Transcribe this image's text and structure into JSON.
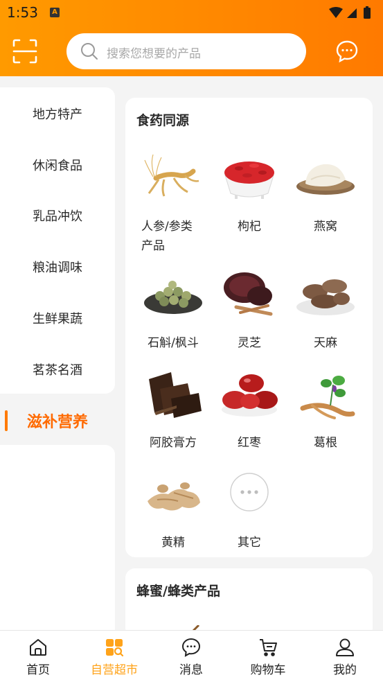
{
  "status_bar": {
    "time": "1:53",
    "badge": "A"
  },
  "search": {
    "placeholder": "搜索您想要的产品"
  },
  "sidebar": {
    "items": [
      {
        "label": "地方特产"
      },
      {
        "label": "休闲食品"
      },
      {
        "label": "乳品冲饮"
      },
      {
        "label": "粮油调味"
      },
      {
        "label": "生鲜果蔬"
      },
      {
        "label": "茗茶名酒"
      }
    ],
    "active": {
      "label": "滋补营养"
    }
  },
  "sections": [
    {
      "title": "食药同源",
      "products": [
        {
          "name": "人参/参类\n产品",
          "icon": "ginseng-image"
        },
        {
          "name": "枸杞",
          "icon": "goji-image"
        },
        {
          "name": "燕窝",
          "icon": "birds-nest-image"
        },
        {
          "name": "石斛/枫斗",
          "icon": "dendrobium-image"
        },
        {
          "name": "灵芝",
          "icon": "lingzhi-image"
        },
        {
          "name": "天麻",
          "icon": "gastrodia-image"
        },
        {
          "name": "阿胶膏方",
          "icon": "ejiao-image"
        },
        {
          "name": "红枣",
          "icon": "red-date-image"
        },
        {
          "name": "葛根",
          "icon": "kudzu-image"
        },
        {
          "name": "黄精",
          "icon": "polygonatum-image"
        },
        {
          "name": "其它",
          "icon": "more-icon"
        }
      ]
    },
    {
      "title": "蜂蜜/蜂类产品"
    }
  ],
  "tabbar": {
    "items": [
      {
        "label": "首页",
        "icon": "home-icon"
      },
      {
        "label": "自营超市",
        "icon": "supermarket-icon"
      },
      {
        "label": "消息",
        "icon": "message-icon"
      },
      {
        "label": "购物车",
        "icon": "cart-icon"
      },
      {
        "label": "我的",
        "icon": "profile-icon"
      }
    ],
    "active_index": 1
  },
  "colors": {
    "accent": "#ff7a00",
    "active_tab": "#ffa31a",
    "active_category": "#ff6a00"
  }
}
